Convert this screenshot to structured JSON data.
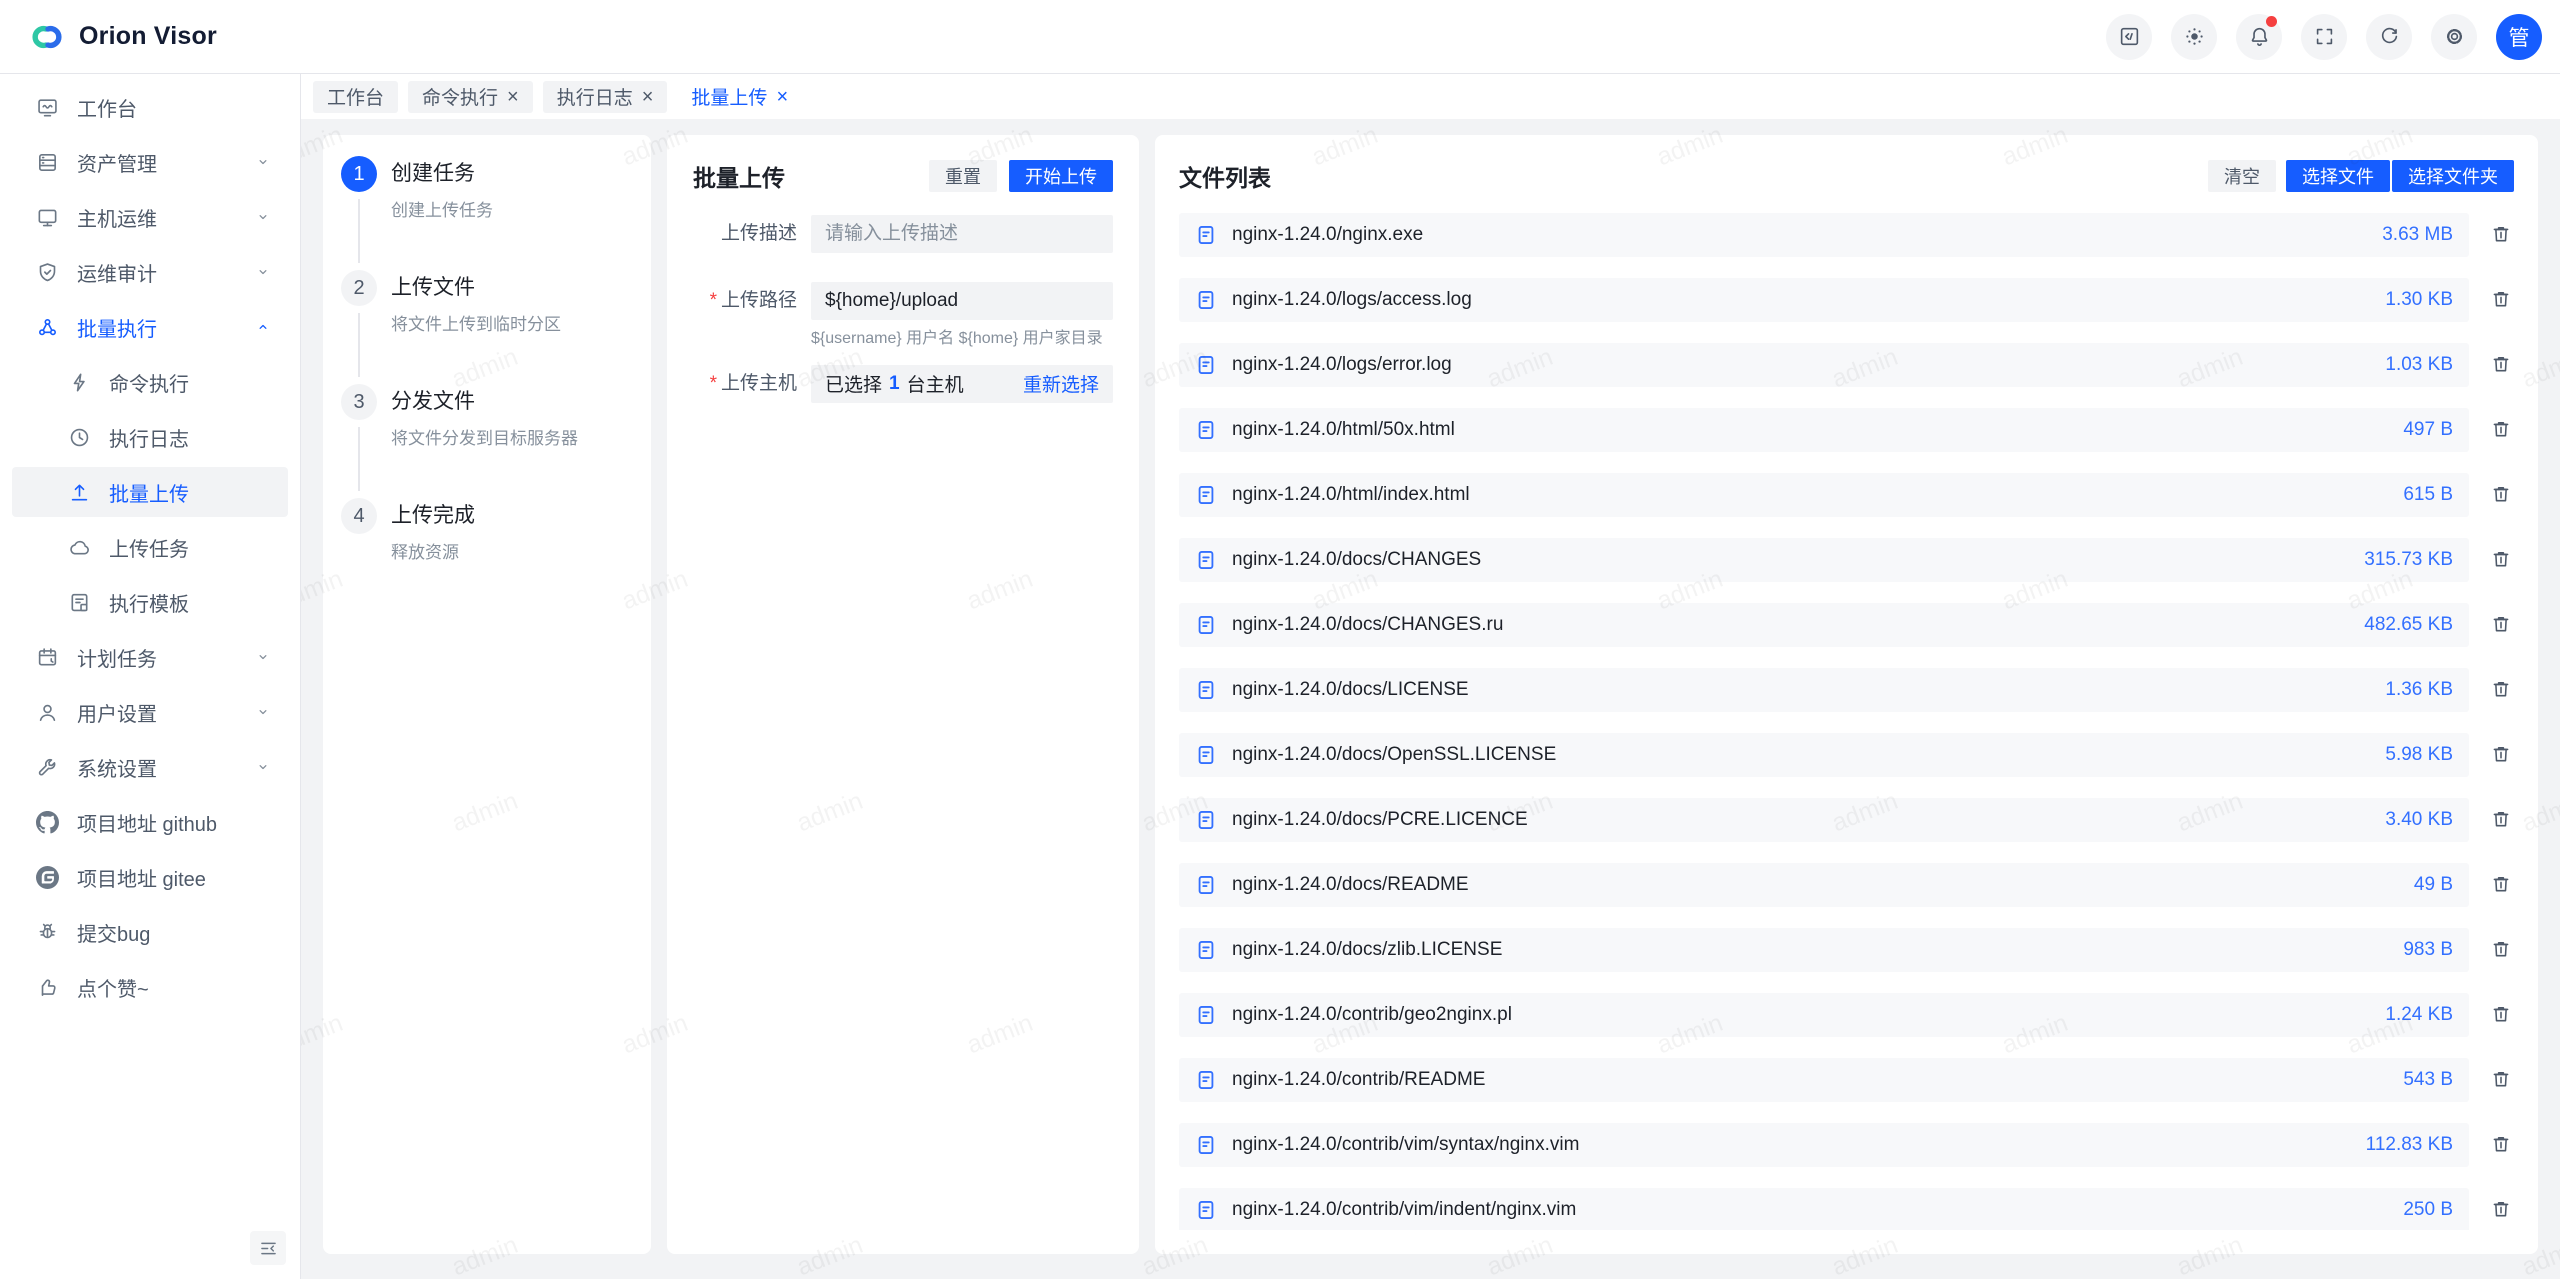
{
  "app": {
    "watermark": "admin"
  },
  "colors": {
    "accent": "#165dff",
    "badge_red": "#f53f3f",
    "file_icon_blue": "#3370ff",
    "size_text_blue": "#3370ff",
    "logo_teal": "#2ec7a5",
    "logo_blue": "#2b6cea"
  },
  "header": {
    "title": "Orion Visor",
    "icons": [
      {
        "name": "code-square-icon",
        "badge": false
      },
      {
        "name": "theme-icon",
        "badge": false
      },
      {
        "name": "notification-icon",
        "badge": true
      },
      {
        "name": "fullscreen-icon",
        "badge": false
      },
      {
        "name": "refresh-icon",
        "badge": false
      },
      {
        "name": "settings-icon",
        "badge": false
      }
    ],
    "avatar_text": "管"
  },
  "tabs": [
    {
      "label": "工作台",
      "closable": false,
      "active": false
    },
    {
      "label": "命令执行",
      "closable": true,
      "active": false
    },
    {
      "label": "执行日志",
      "closable": true,
      "active": false
    },
    {
      "label": "批量上传",
      "closable": true,
      "active": true
    }
  ],
  "sidebar": {
    "items": [
      {
        "icon": "workbench-icon",
        "label": "工作台",
        "chevron": false,
        "sub": false,
        "active": false,
        "expanded": false
      },
      {
        "icon": "assets-icon",
        "label": "资产管理",
        "chevron": true,
        "sub": false,
        "active": false,
        "expanded": false
      },
      {
        "icon": "host-ops-icon",
        "label": "主机运维",
        "chevron": true,
        "sub": false,
        "active": false,
        "expanded": false
      },
      {
        "icon": "audit-icon",
        "label": "运维审计",
        "chevron": true,
        "sub": false,
        "active": false,
        "expanded": false
      },
      {
        "icon": "batch-exec-icon",
        "label": "批量执行",
        "chevron": true,
        "sub": false,
        "active": false,
        "expanded": true
      },
      {
        "icon": "command-icon",
        "label": "命令执行",
        "chevron": false,
        "sub": true,
        "active": false,
        "expanded": false
      },
      {
        "icon": "history-icon",
        "label": "执行日志",
        "chevron": false,
        "sub": true,
        "active": false,
        "expanded": false
      },
      {
        "icon": "upload-icon",
        "label": "批量上传",
        "chevron": false,
        "sub": true,
        "active": true,
        "expanded": false
      },
      {
        "icon": "cloud-icon",
        "label": "上传任务",
        "chevron": false,
        "sub": true,
        "active": false,
        "expanded": false
      },
      {
        "icon": "template-icon",
        "label": "执行模板",
        "chevron": false,
        "sub": true,
        "active": false,
        "expanded": false
      },
      {
        "icon": "schedule-icon",
        "label": "计划任务",
        "chevron": true,
        "sub": false,
        "active": false,
        "expanded": false
      },
      {
        "icon": "user-icon",
        "label": "用户设置",
        "chevron": true,
        "sub": false,
        "active": false,
        "expanded": false
      },
      {
        "icon": "system-icon",
        "label": "系统设置",
        "chevron": true,
        "sub": false,
        "active": false,
        "expanded": false
      },
      {
        "icon": "github-icon",
        "label": "项目地址 github",
        "chevron": false,
        "sub": false,
        "active": false,
        "expanded": false
      },
      {
        "icon": "gitee-icon",
        "label": "项目地址 gitee",
        "chevron": false,
        "sub": false,
        "active": false,
        "expanded": false
      },
      {
        "icon": "bug-icon",
        "label": "提交bug",
        "chevron": false,
        "sub": false,
        "active": false,
        "expanded": false
      },
      {
        "icon": "like-icon",
        "label": "点个赞~",
        "chevron": false,
        "sub": false,
        "active": false,
        "expanded": false
      }
    ]
  },
  "steps": [
    {
      "num": "1",
      "title": "创建任务",
      "desc": "创建上传任务",
      "active": true
    },
    {
      "num": "2",
      "title": "上传文件",
      "desc": "将文件上传到临时分区",
      "active": false
    },
    {
      "num": "3",
      "title": "分发文件",
      "desc": "将文件分发到目标服务器",
      "active": false
    },
    {
      "num": "4",
      "title": "上传完成",
      "desc": "释放资源",
      "active": false
    }
  ],
  "upload_form": {
    "title": "批量上传",
    "reset_label": "重置",
    "start_label": "开始上传",
    "fields": {
      "description": {
        "label": "上传描述",
        "placeholder": "请输入上传描述",
        "required": false
      },
      "path": {
        "label": "上传路径",
        "value": "${home}/upload",
        "required": true,
        "helper": "${username} 用户名 ${home} 用户家目录"
      },
      "hosts": {
        "label": "上传主机",
        "required": true,
        "selected_prefix": "已选择",
        "selected_count": "1",
        "selected_suffix": "台主机",
        "reselect_label": "重新选择"
      }
    }
  },
  "file_list": {
    "title": "文件列表",
    "clear_label": "清空",
    "select_file_label": "选择文件",
    "select_folder_label": "选择文件夹",
    "files": [
      {
        "name": "nginx-1.24.0/nginx.exe",
        "size": "3.63 MB"
      },
      {
        "name": "nginx-1.24.0/logs/access.log",
        "size": "1.30 KB"
      },
      {
        "name": "nginx-1.24.0/logs/error.log",
        "size": "1.03 KB"
      },
      {
        "name": "nginx-1.24.0/html/50x.html",
        "size": "497 B"
      },
      {
        "name": "nginx-1.24.0/html/index.html",
        "size": "615 B"
      },
      {
        "name": "nginx-1.24.0/docs/CHANGES",
        "size": "315.73 KB"
      },
      {
        "name": "nginx-1.24.0/docs/CHANGES.ru",
        "size": "482.65 KB"
      },
      {
        "name": "nginx-1.24.0/docs/LICENSE",
        "size": "1.36 KB"
      },
      {
        "name": "nginx-1.24.0/docs/OpenSSL.LICENSE",
        "size": "5.98 KB"
      },
      {
        "name": "nginx-1.24.0/docs/PCRE.LICENCE",
        "size": "3.40 KB"
      },
      {
        "name": "nginx-1.24.0/docs/README",
        "size": "49 B"
      },
      {
        "name": "nginx-1.24.0/docs/zlib.LICENSE",
        "size": "983 B"
      },
      {
        "name": "nginx-1.24.0/contrib/geo2nginx.pl",
        "size": "1.24 KB"
      },
      {
        "name": "nginx-1.24.0/contrib/README",
        "size": "543 B"
      },
      {
        "name": "nginx-1.24.0/contrib/vim/syntax/nginx.vim",
        "size": "112.83 KB"
      },
      {
        "name": "nginx-1.24.0/contrib/vim/indent/nginx.vim",
        "size": "250 B"
      }
    ]
  }
}
